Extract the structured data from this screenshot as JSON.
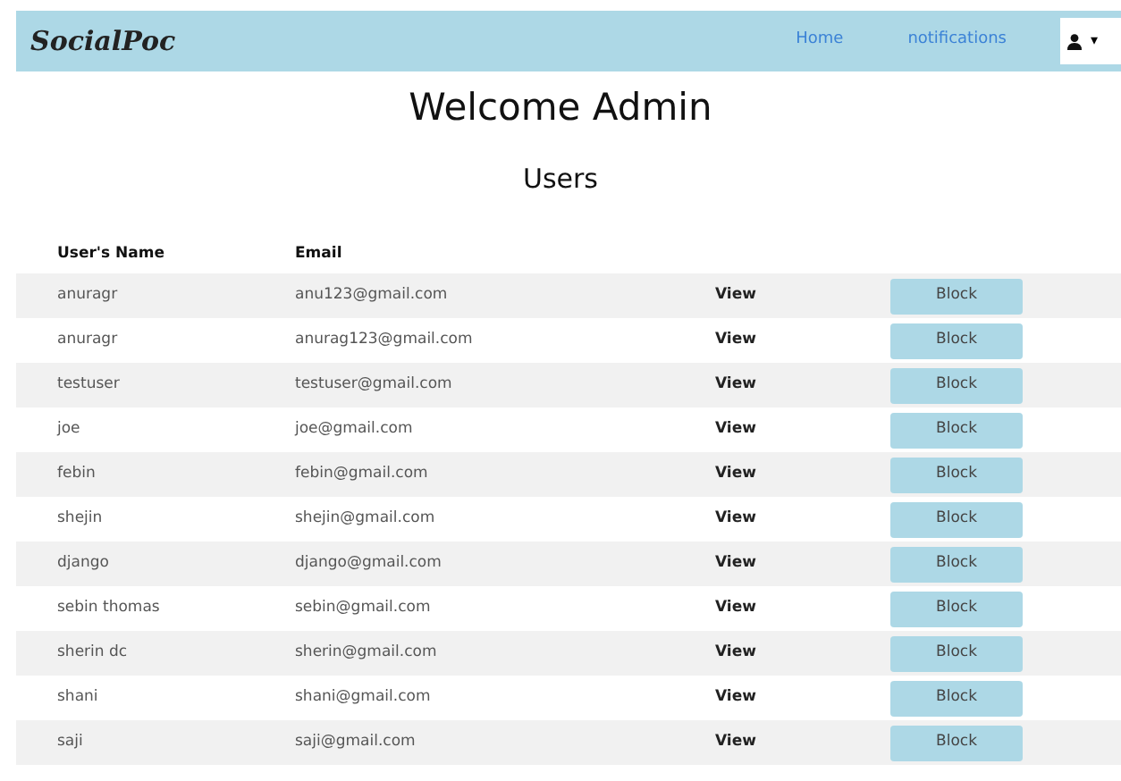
{
  "navbar": {
    "brand": "SocialPoc",
    "links": [
      {
        "label": "Home"
      },
      {
        "label": "notifications"
      }
    ],
    "user_menu": {
      "caret": "▾"
    }
  },
  "heading": "Welcome Admin",
  "subheading": "Users",
  "table": {
    "columns": [
      "User's Name",
      "Email"
    ],
    "rows": [
      {
        "name": "anuragr",
        "email": "anu123@gmail.com",
        "view": "View",
        "action": "Block"
      },
      {
        "name": "anuragr",
        "email": "anurag123@gmail.com",
        "view": "View",
        "action": "Block"
      },
      {
        "name": "testuser",
        "email": "testuser@gmail.com",
        "view": "View",
        "action": "Block"
      },
      {
        "name": "joe",
        "email": "joe@gmail.com",
        "view": "View",
        "action": "Block"
      },
      {
        "name": "febin",
        "email": "febin@gmail.com",
        "view": "View",
        "action": "Block"
      },
      {
        "name": "shejin",
        "email": "shejin@gmail.com",
        "view": "View",
        "action": "Block"
      },
      {
        "name": "django",
        "email": "django@gmail.com",
        "view": "View",
        "action": "Block"
      },
      {
        "name": "sebin thomas",
        "email": "sebin@gmail.com",
        "view": "View",
        "action": "Block"
      },
      {
        "name": "sherin dc",
        "email": "sherin@gmail.com",
        "view": "View",
        "action": "Block"
      },
      {
        "name": "shani",
        "email": "shani@gmail.com",
        "view": "View",
        "action": "Block"
      },
      {
        "name": "saji",
        "email": "saji@gmail.com",
        "view": "View",
        "action": "Block"
      }
    ]
  }
}
